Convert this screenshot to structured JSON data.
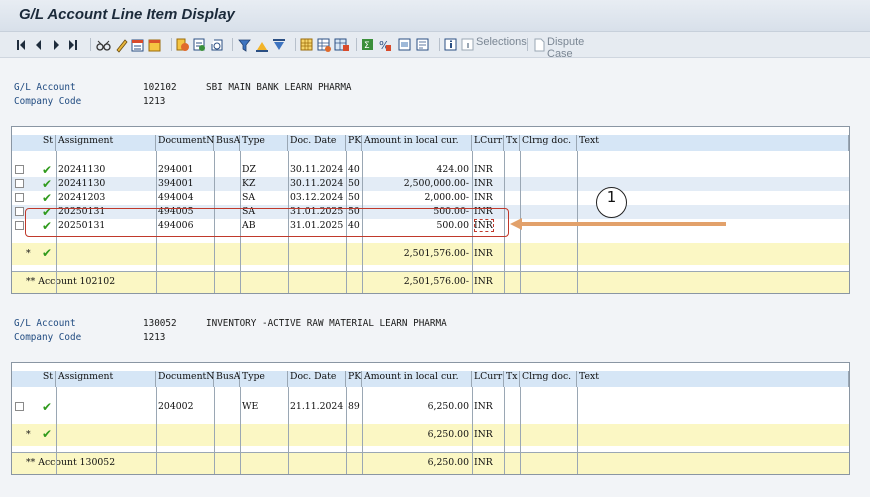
{
  "window": {
    "title": "G/L Account Line Item Display"
  },
  "toolbar": {
    "selections_label": "Selections",
    "dispute_label": "Dispute Case",
    "icons": [
      "first-page-icon",
      "prev-page-icon",
      "next-page-icon",
      "last-page-icon",
      "glasses-icon",
      "pencil-icon",
      "layout-icon",
      "calendar-icon",
      "doc-split-icon",
      "doc-change-icon",
      "refresh-icon",
      "filter-icon",
      "sort-asc-icon",
      "sort-desc-icon",
      "grid-icon",
      "export-icon",
      "spreadsheet-icon",
      "sum-icon",
      "subtotal-icon",
      "print-preview-icon",
      "attachment-icon",
      "info-icon"
    ]
  },
  "labels": {
    "account": "G/L Account",
    "company": "Company Code",
    "columns": [
      "St",
      "Assignment",
      "DocumentNo",
      "BusA",
      "Type",
      "Doc. Date",
      "PK",
      "Amount in local cur.",
      "LCurr",
      "Tx",
      "Clrng doc.",
      "Text"
    ]
  },
  "blocks": [
    {
      "account": "102102",
      "account_name": "SBI MAIN BANK LEARN PHARMA",
      "company": "1213",
      "rows": [
        {
          "assign": "20241130",
          "doc": "294001",
          "type": "DZ",
          "date": "30.11.2024",
          "pk": "40",
          "amount": "424.00",
          "curr": "INR"
        },
        {
          "assign": "20241130",
          "doc": "394001",
          "type": "KZ",
          "date": "30.11.2024",
          "pk": "50",
          "amount": "2,500,000.00-",
          "curr": "INR"
        },
        {
          "assign": "20241203",
          "doc": "494004",
          "type": "SA",
          "date": "03.12.2024",
          "pk": "50",
          "amount": "2,000.00-",
          "curr": "INR"
        },
        {
          "assign": "20250131",
          "doc": "494005",
          "type": "SA",
          "date": "31.01.2025",
          "pk": "50",
          "amount": "500.00-",
          "curr": "INR"
        },
        {
          "assign": "20250131",
          "doc": "494006",
          "type": "AB",
          "date": "31.01.2025",
          "pk": "40",
          "amount": "500.00",
          "curr": "INR"
        }
      ],
      "subtotal_marker": "*",
      "subtotal_amount": "2,501,576.00-",
      "subtotal_curr": "INR",
      "total_label": "** Account 102102",
      "total_amount": "2,501,576.00-",
      "total_curr": "INR"
    },
    {
      "account": "130052",
      "account_name": "INVENTORY -ACTIVE RAW MATERIAL LEARN PHARMA",
      "company": "1213",
      "rows": [
        {
          "assign": "",
          "doc": "204002",
          "type": "WE",
          "date": "21.11.2024",
          "pk": "89",
          "amount": "6,250.00",
          "curr": "INR"
        }
      ],
      "subtotal_marker": "*",
      "subtotal_amount": "6,250.00",
      "subtotal_curr": "INR",
      "total_label": "** Account 130052",
      "total_amount": "6,250.00",
      "total_curr": "INR"
    }
  ],
  "annotation": {
    "number": "1"
  },
  "colors": {
    "header_blue": "#d6e6f6",
    "row_stripe": "#e3ecf6",
    "total_yellow": "#fbf7c4",
    "tick_green": "#2f9a1c",
    "callout_red": "#c0392b",
    "arrow_orange": "#e2a16b"
  }
}
